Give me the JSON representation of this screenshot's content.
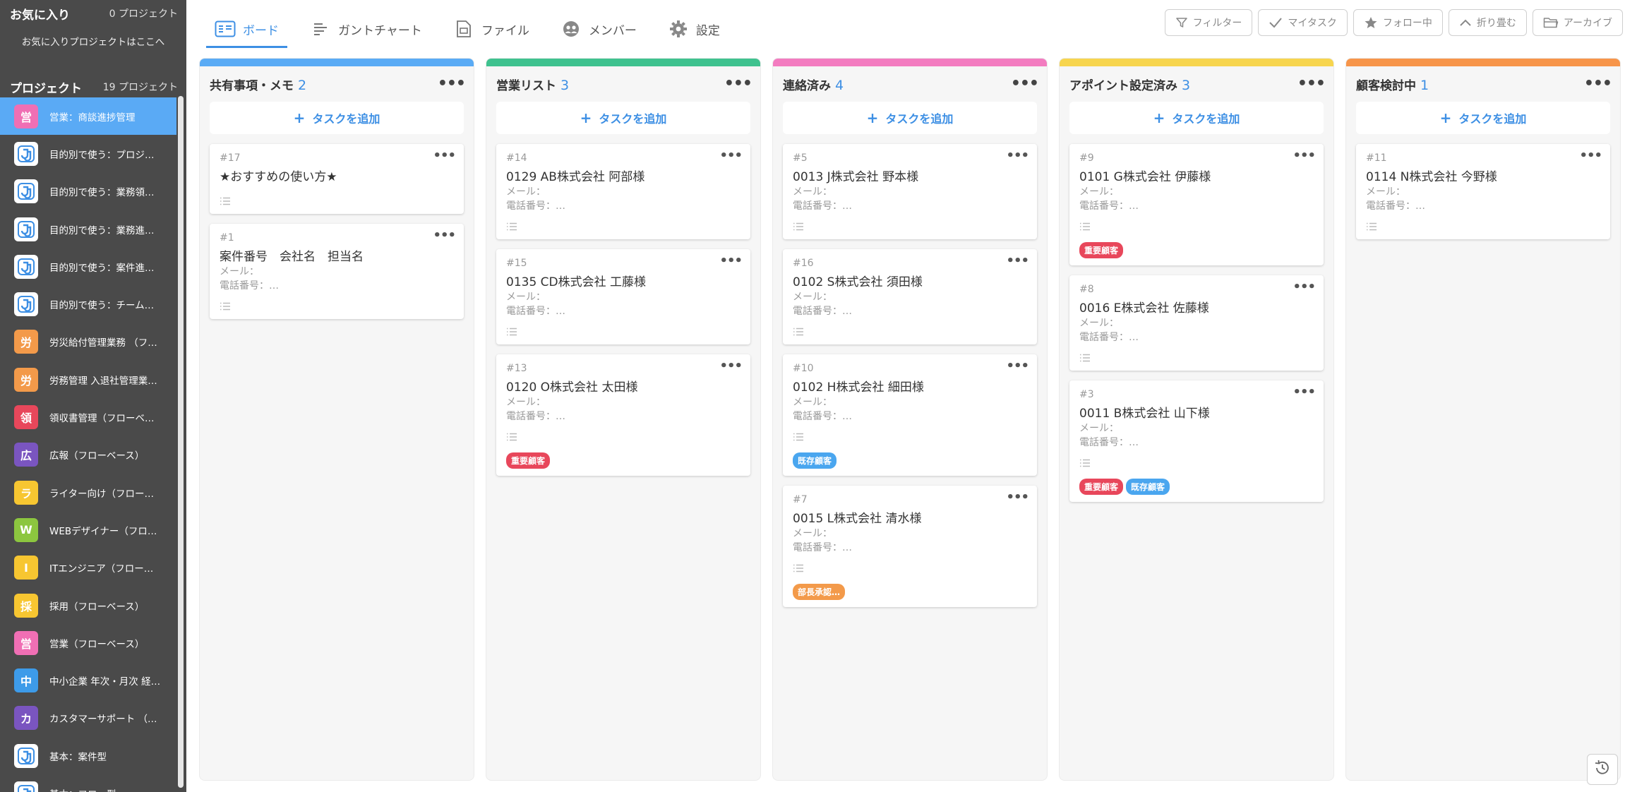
{
  "sidebar": {
    "favorites_title": "お気に入り",
    "favorites_count": "0 プロジェクト",
    "favorites_empty": "お気に入りプロジェクトはここへ",
    "projects_title": "プロジェクト",
    "projects_count": "19 プロジェクト",
    "projects": [
      {
        "badge": "営",
        "color": "#f06fb4",
        "label": "営業：商談進捗管理",
        "active": true
      },
      {
        "badge": "logo",
        "color": "#ffffff",
        "label": "目的別で使う：プロジ…"
      },
      {
        "badge": "logo",
        "color": "#ffffff",
        "label": "目的別で使う：業務領…"
      },
      {
        "badge": "logo",
        "color": "#ffffff",
        "label": "目的別で使う：業務進…"
      },
      {
        "badge": "logo",
        "color": "#ffffff",
        "label": "目的別で使う：案件進…"
      },
      {
        "badge": "logo",
        "color": "#ffffff",
        "label": "目的別で使う：チーム…"
      },
      {
        "badge": "労",
        "color": "#f39a4a",
        "label": "労災給付管理業務 （フ…"
      },
      {
        "badge": "労",
        "color": "#f39a4a",
        "label": "労務管理 入退社管理業…"
      },
      {
        "badge": "領",
        "color": "#e8475b",
        "label": "領収書管理（フローベ…"
      },
      {
        "badge": "広",
        "color": "#7a55c0",
        "label": "広報（フローベース）"
      },
      {
        "badge": "ラ",
        "color": "#f7c631",
        "label": "ライター向け（フロー…"
      },
      {
        "badge": "W",
        "color": "#8cc63f",
        "label": "WEBデザイナー（フロ…"
      },
      {
        "badge": "I",
        "color": "#f7c631",
        "label": "ITエンジニア（フロー…"
      },
      {
        "badge": "採",
        "color": "#f7c631",
        "label": "採用（フローベース）"
      },
      {
        "badge": "営",
        "color": "#f06fb4",
        "label": "営業（フローベース）"
      },
      {
        "badge": "中",
        "color": "#3d9be9",
        "label": "中小企業 年次・月次 経…"
      },
      {
        "badge": "カ",
        "color": "#7a55c0",
        "label": "カスタマーサポート （…"
      },
      {
        "badge": "logo",
        "color": "#ffffff",
        "label": "基本：案件型"
      },
      {
        "badge": "logo",
        "color": "#ffffff",
        "label": "基本：フロー型"
      }
    ]
  },
  "nav": {
    "tabs": [
      {
        "label": "ボード",
        "icon": "board-icon",
        "active": true
      },
      {
        "label": "ガントチャート",
        "icon": "gantt-icon"
      },
      {
        "label": "ファイル",
        "icon": "file-icon"
      },
      {
        "label": "メンバー",
        "icon": "members-icon"
      },
      {
        "label": "設定",
        "icon": "gear-icon"
      }
    ]
  },
  "toolbar": {
    "filter": "フィルター",
    "my_tasks": "マイタスク",
    "following": "フォロー中",
    "collapse": "折り畳む",
    "archive": "アーカイブ"
  },
  "board": {
    "add_task_label": "タスクを追加",
    "field_mail": "メール：",
    "field_phone": "電話番号：…",
    "columns": [
      {
        "title": "共有事項・メモ",
        "count": "2",
        "color": "#5aabf5",
        "cards": [
          {
            "id": "#17",
            "title": "★おすすめの使い方★",
            "fields": false,
            "tags": []
          },
          {
            "id": "#1",
            "title": "案件番号　会社名　担当名",
            "fields": true,
            "tags": []
          }
        ]
      },
      {
        "title": "営業リスト",
        "count": "3",
        "color": "#3fc28f",
        "cards": [
          {
            "id": "#14",
            "title": "0129 AB株式会社 阿部様",
            "fields": true,
            "tags": []
          },
          {
            "id": "#15",
            "title": "0135 CD株式会社 工藤様",
            "fields": true,
            "tags": []
          },
          {
            "id": "#13",
            "title": "0120 O株式会社 太田様",
            "fields": true,
            "tags": [
              {
                "label": "重要顧客",
                "color": "#e8475b"
              }
            ]
          }
        ]
      },
      {
        "title": "連絡済み",
        "count": "4",
        "color": "#f37cc0",
        "cards": [
          {
            "id": "#5",
            "title": "0013 J株式会社 野本様",
            "fields": true,
            "tags": []
          },
          {
            "id": "#16",
            "title": "0102 S株式会社 須田様",
            "fields": true,
            "tags": []
          },
          {
            "id": "#10",
            "title": "0102 H株式会社 細田様",
            "fields": true,
            "tags": [
              {
                "label": "既存顧客",
                "color": "#4aa6ef"
              }
            ]
          },
          {
            "id": "#7",
            "title": "0015 L株式会社 清水様",
            "fields": true,
            "tags": [
              {
                "label": "部長承認…",
                "color": "#f39a4a"
              }
            ]
          }
        ]
      },
      {
        "title": "アポイント設定済み",
        "count": "3",
        "color": "#f7d54e",
        "cards": [
          {
            "id": "#9",
            "title": "0101 G株式会社 伊藤様",
            "fields": true,
            "tags": [
              {
                "label": "重要顧客",
                "color": "#e8475b"
              }
            ]
          },
          {
            "id": "#8",
            "title": "0016 E株式会社 佐藤様",
            "fields": true,
            "tags": []
          },
          {
            "id": "#3",
            "title": "0011 B株式会社 山下様",
            "fields": true,
            "tags": [
              {
                "label": "重要顧客",
                "color": "#e8475b"
              },
              {
                "label": "既存顧客",
                "color": "#4aa6ef"
              }
            ]
          }
        ]
      },
      {
        "title": "顧客検討中",
        "count": "1",
        "color": "#f7954a",
        "cards": [
          {
            "id": "#11",
            "title": "0114 N株式会社 今野様",
            "fields": true,
            "tags": []
          }
        ]
      }
    ]
  }
}
